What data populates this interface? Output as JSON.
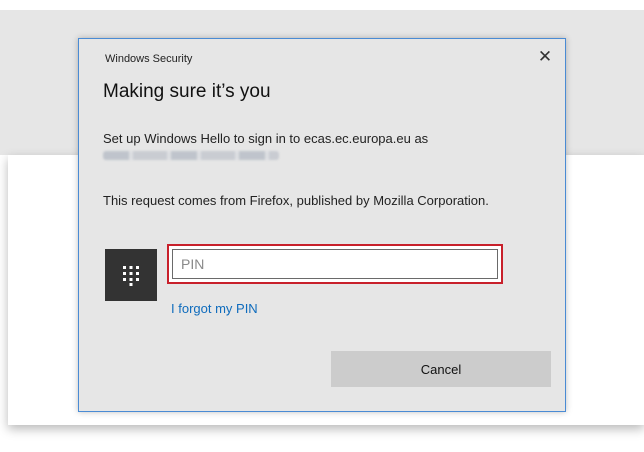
{
  "dialog": {
    "window_title": "Windows Security",
    "close_glyph": "✕",
    "heading": "Making sure it’s you",
    "description": "Set up Windows Hello to sign in to ecas.ec.europa.eu as",
    "request_text": "This request comes from Firefox, published by Mozilla Corporation.",
    "pin": {
      "value": "",
      "placeholder": "PIN",
      "icon": "keypad-icon"
    },
    "forgot_link": "I forgot my PIN",
    "cancel_label": "Cancel",
    "colors": {
      "focus_border": "#c8202b",
      "link": "#0f6cbd",
      "dialog_border": "#4a8bd4",
      "button_bg": "#cccccc"
    }
  }
}
